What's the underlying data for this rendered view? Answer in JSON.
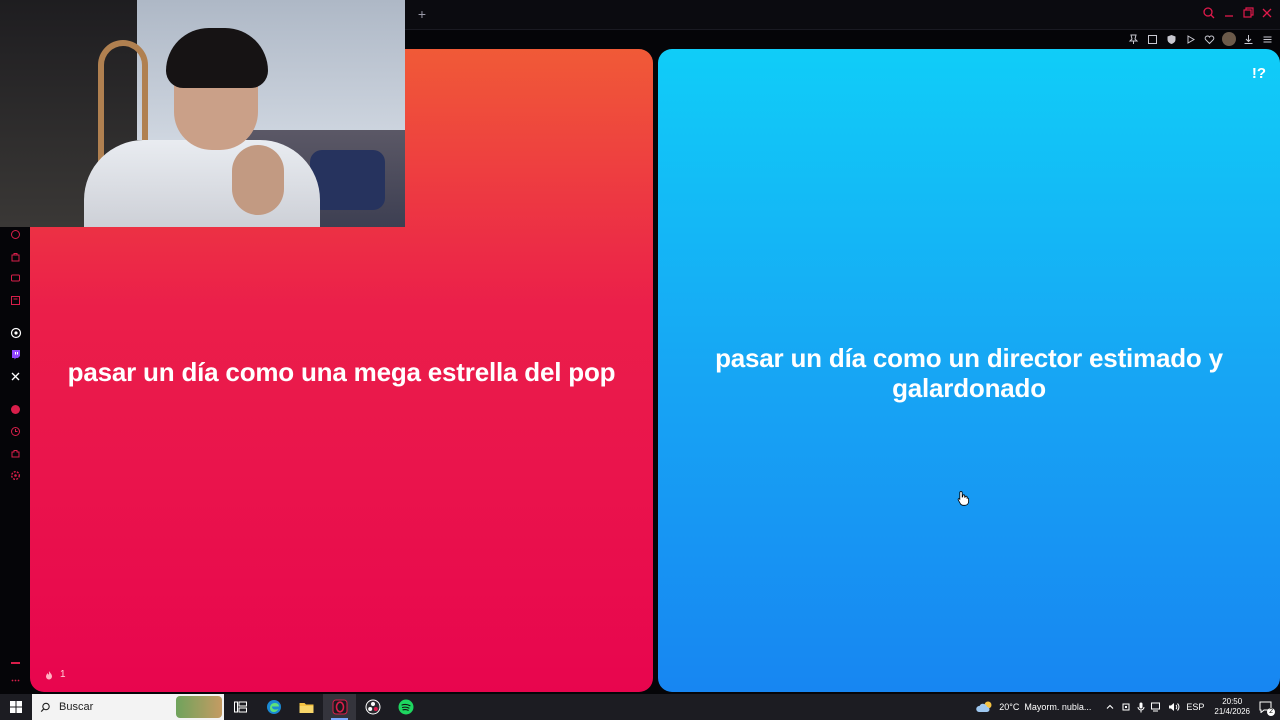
{
  "browser": {
    "new_tab_label": "+",
    "accent_color": "#e0194b"
  },
  "left_card": {
    "option_text": "pasar un día como una mega estrella del pop",
    "likes_count": "1",
    "gradient_colors": [
      "#f05a37",
      "#e8054e"
    ]
  },
  "right_card": {
    "option_text": "pasar un día como un director estimado y galardonado",
    "brand_mark": "!?",
    "gradient_colors": [
      "#10cdf8",
      "#1786f2"
    ]
  },
  "taskbar": {
    "search_placeholder": "Buscar",
    "weather_temp": "20°C",
    "weather_desc": "Mayorm. nubla...",
    "language": "ESP",
    "time": "20:50",
    "date": "21/4/2026",
    "notification_count": "2"
  }
}
